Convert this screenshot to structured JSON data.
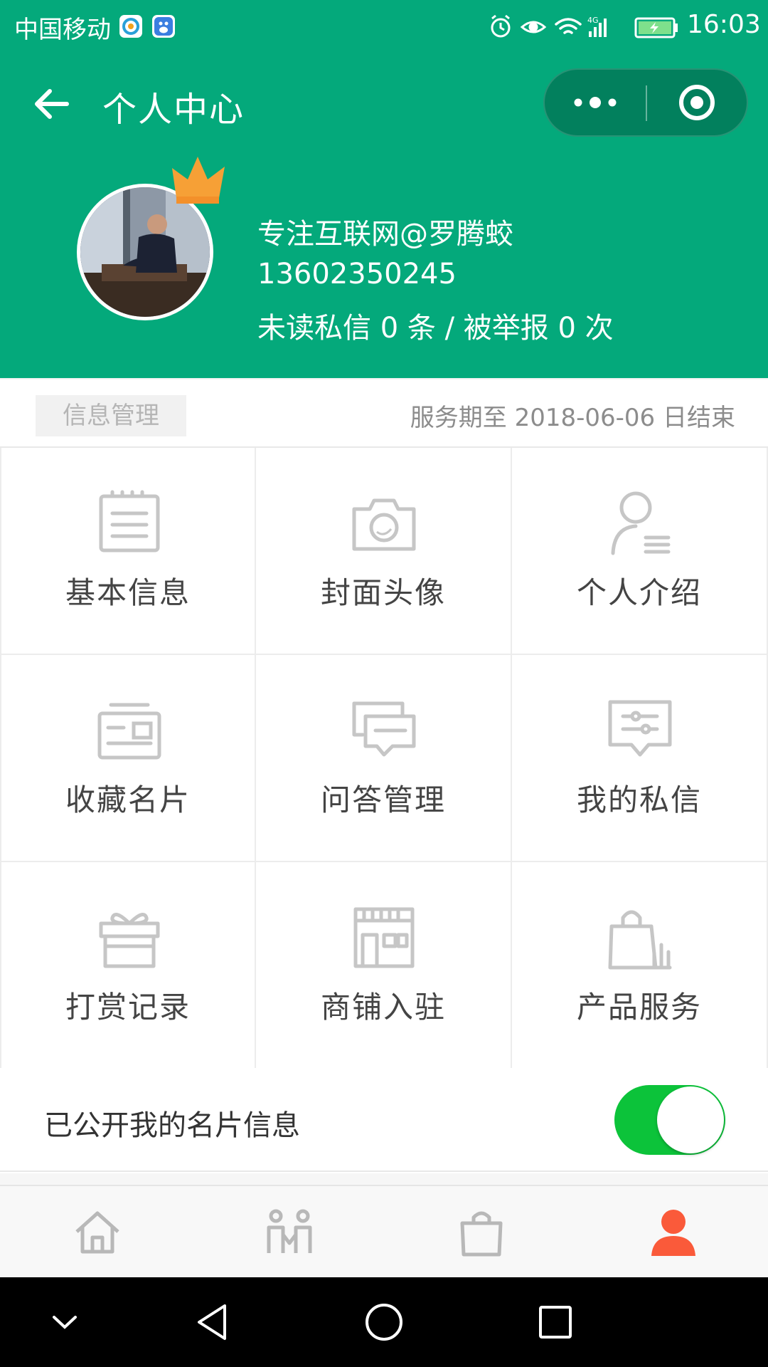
{
  "status_bar": {
    "carrier": "中国移动",
    "network": "4G",
    "time": "16:03",
    "icons": [
      "map-app-icon",
      "baidu-app-icon",
      "alarm-icon",
      "eye-icon",
      "wifi-icon",
      "signal-icon",
      "battery-icon"
    ]
  },
  "nav": {
    "title": "个人中心",
    "back_icon": "back-arrow-icon",
    "more_icon": "more-dots-icon",
    "close_icon": "mini-program-close-icon"
  },
  "profile": {
    "name": "专注互联网@罗腾蛟",
    "phone": "13602350245",
    "stats": "未读私信 0 条 / 被举报 0 次",
    "badge_icon": "crown-icon"
  },
  "info": {
    "section_tab": "信息管理",
    "service_text": "服务期至 2018-06-06 日结束"
  },
  "grid": {
    "items": [
      {
        "label": "基本信息",
        "icon": "document-icon"
      },
      {
        "label": "封面头像",
        "icon": "camera-icon"
      },
      {
        "label": "个人介绍",
        "icon": "person-list-icon"
      },
      {
        "label": "收藏名片",
        "icon": "business-card-icon"
      },
      {
        "label": "问答管理",
        "icon": "chat-bubbles-icon"
      },
      {
        "label": "我的私信",
        "icon": "message-settings-icon"
      },
      {
        "label": "打赏记录",
        "icon": "gift-icon"
      },
      {
        "label": "商铺入驻",
        "icon": "store-icon"
      },
      {
        "label": "产品服务",
        "icon": "shopping-bag-chart-icon"
      }
    ]
  },
  "public_toggle": {
    "label": "已公开我的名片信息",
    "on": true,
    "color": "#0cc33a"
  },
  "tabbar": {
    "tabs": [
      {
        "icon": "home-icon",
        "active": false
      },
      {
        "icon": "people-icon",
        "active": false
      },
      {
        "icon": "bag-icon",
        "active": false
      },
      {
        "icon": "user-icon",
        "active": true
      }
    ],
    "active_color": "#fa5a3a",
    "inactive_color": "#b8b8b8"
  },
  "colors": {
    "brand_green": "#04a97b",
    "capsule": "#02805d"
  }
}
